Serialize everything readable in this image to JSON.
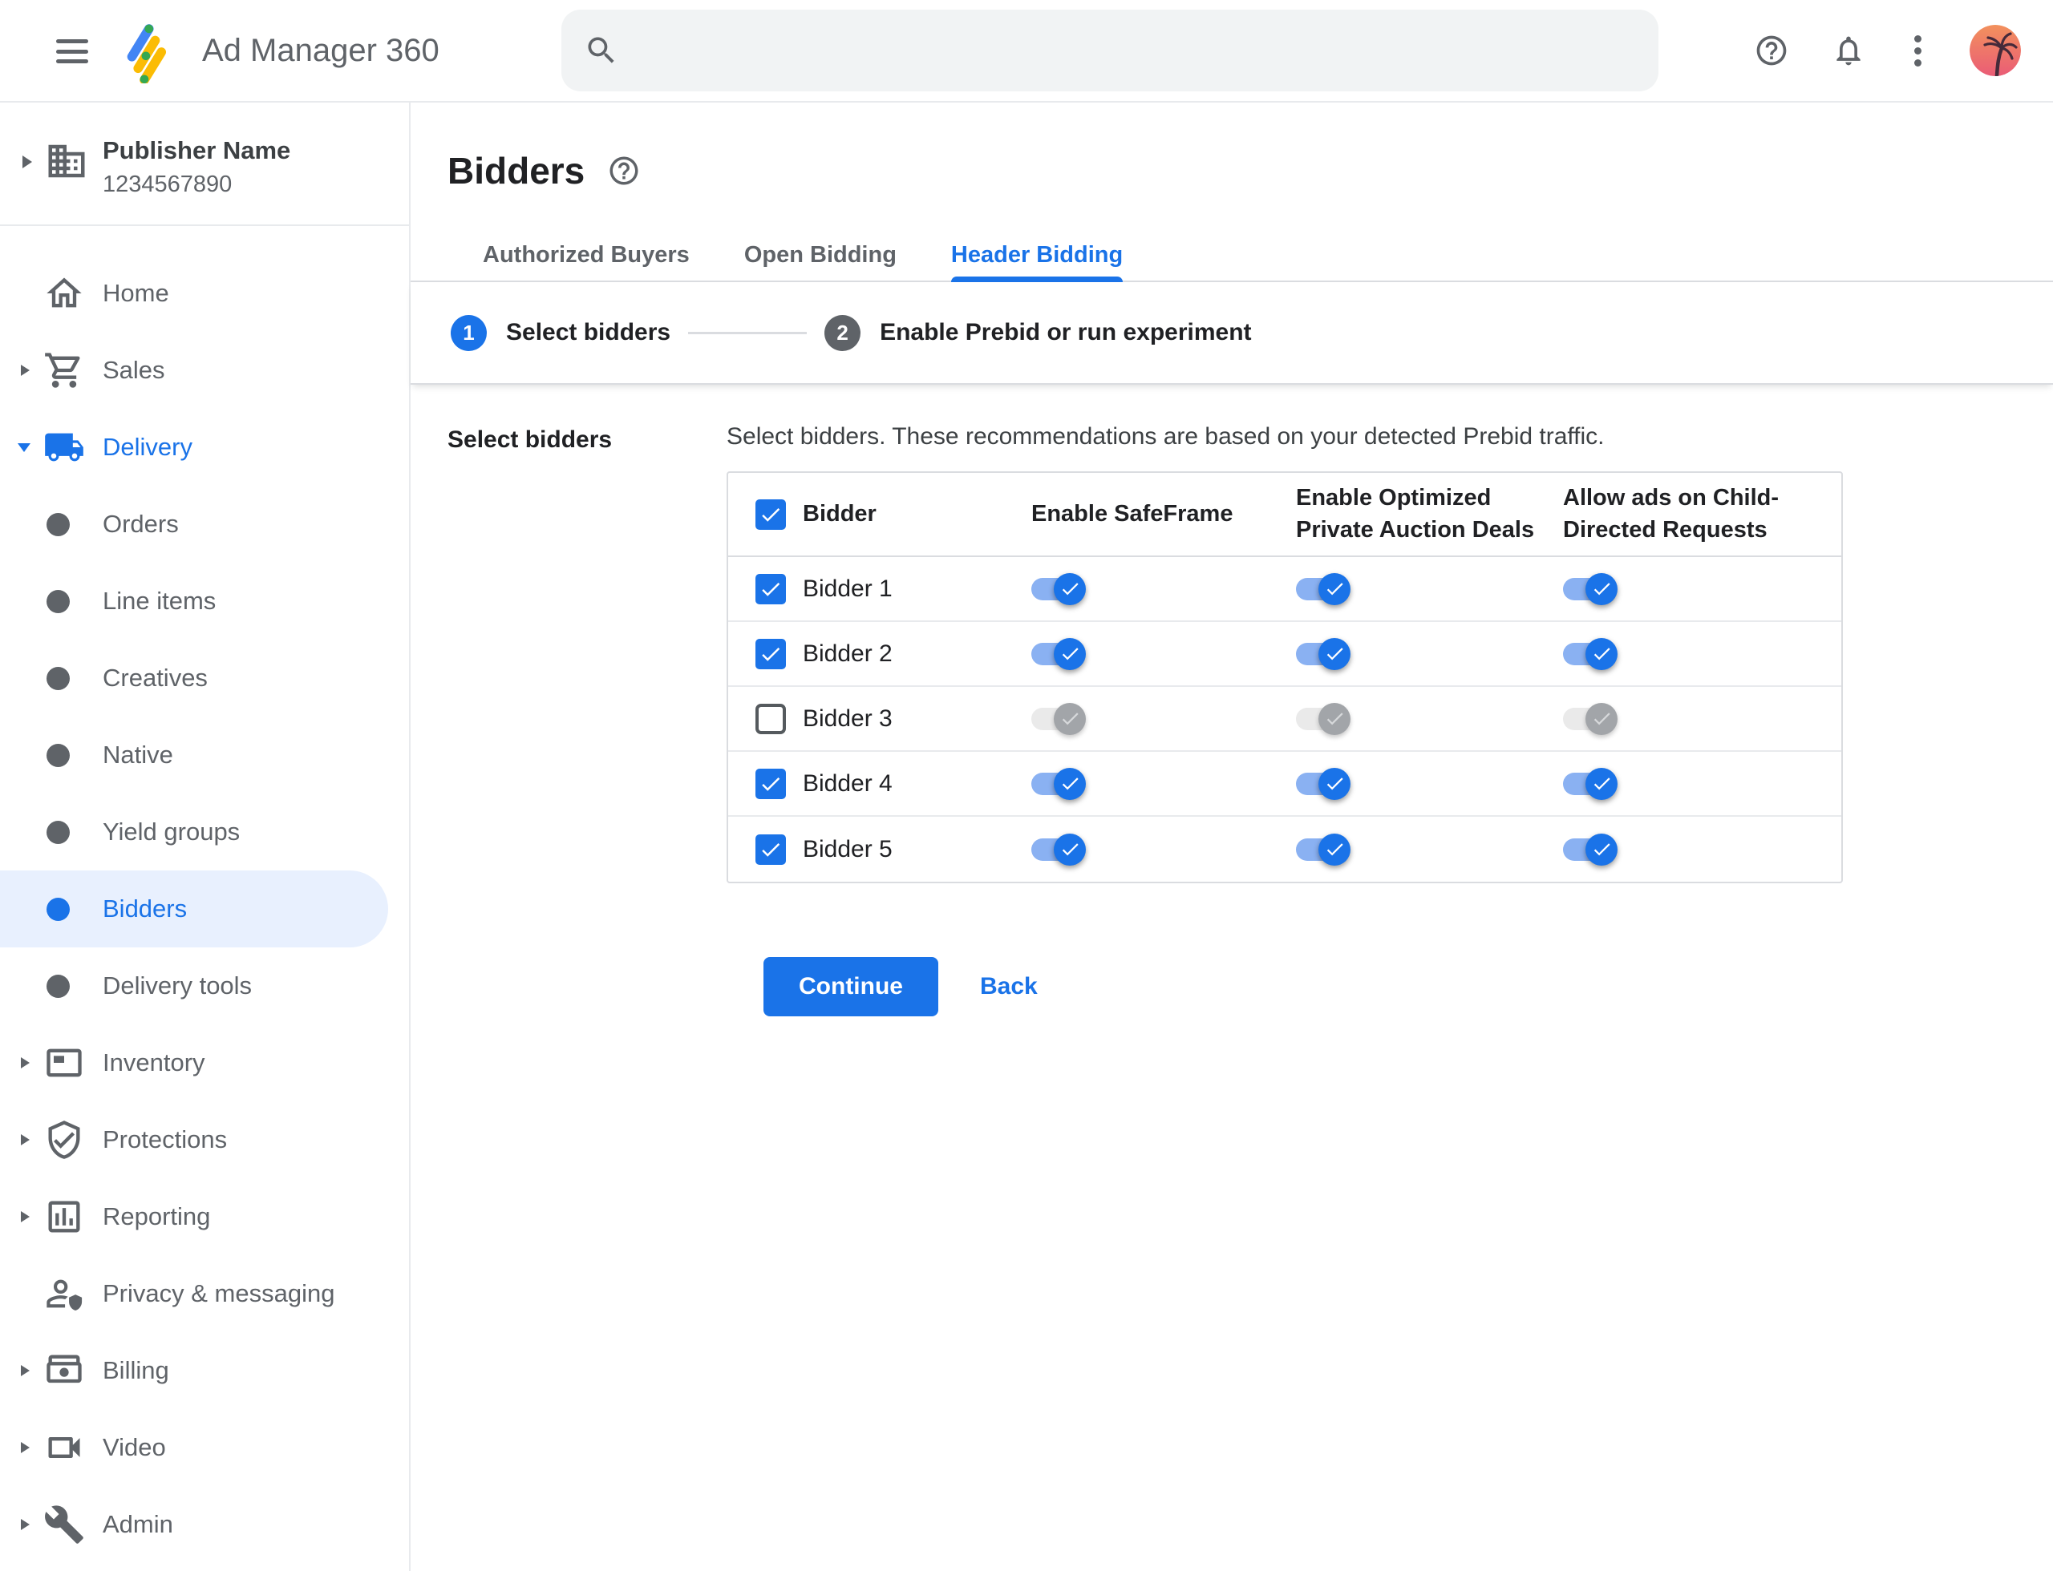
{
  "topbar": {
    "product_name": "Ad Manager 360",
    "search": {
      "placeholder": ""
    }
  },
  "sidebar": {
    "publisher": {
      "name": "Publisher Name",
      "id": "1234567890"
    },
    "items": [
      {
        "label": "Home",
        "icon": "home",
        "arrow": "none",
        "state": "default"
      },
      {
        "label": "Sales",
        "icon": "cart",
        "arrow": "right",
        "state": "default"
      },
      {
        "label": "Delivery",
        "icon": "truck",
        "arrow": "down",
        "state": "blue"
      },
      {
        "label": "Orders",
        "icon": "bullet",
        "arrow": "none",
        "state": "default"
      },
      {
        "label": "Line items",
        "icon": "bullet",
        "arrow": "none",
        "state": "default"
      },
      {
        "label": "Creatives",
        "icon": "bullet",
        "arrow": "none",
        "state": "default"
      },
      {
        "label": "Native",
        "icon": "bullet",
        "arrow": "none",
        "state": "default"
      },
      {
        "label": "Yield groups",
        "icon": "bullet",
        "arrow": "none",
        "state": "default"
      },
      {
        "label": "Bidders",
        "icon": "bullet",
        "arrow": "none",
        "state": "selected"
      },
      {
        "label": "Delivery tools",
        "icon": "bullet",
        "arrow": "none",
        "state": "default"
      },
      {
        "label": "Inventory",
        "icon": "inventory",
        "arrow": "right",
        "state": "default"
      },
      {
        "label": "Protections",
        "icon": "shield",
        "arrow": "right",
        "state": "default"
      },
      {
        "label": "Reporting",
        "icon": "report",
        "arrow": "right",
        "state": "default"
      },
      {
        "label": "Privacy & messaging",
        "icon": "privacy",
        "arrow": "none",
        "state": "default"
      },
      {
        "label": "Billing",
        "icon": "billing",
        "arrow": "right",
        "state": "default"
      },
      {
        "label": "Video",
        "icon": "video",
        "arrow": "right",
        "state": "default"
      },
      {
        "label": "Admin",
        "icon": "admin",
        "arrow": "right",
        "state": "default"
      }
    ]
  },
  "main": {
    "title": "Bidders",
    "tabs": [
      {
        "label": "Authorized Buyers",
        "active": false
      },
      {
        "label": "Open Bidding",
        "active": false
      },
      {
        "label": "Header Bidding",
        "active": true
      }
    ],
    "steps": [
      {
        "number": "1",
        "label": "Select bidders",
        "state": "active"
      },
      {
        "number": "2",
        "label": "Enable Prebid or run experiment",
        "state": "inactive"
      }
    ],
    "form": {
      "section_label": "Select bidders",
      "description": "Select bidders. These recommendations are based on your detected Prebid traffic.",
      "table": {
        "select_all_checked": true,
        "columns": [
          "Bidder",
          "Enable SafeFrame",
          "Enable Optimized Private Auction Deals",
          "Allow ads on Child-Directed Requests"
        ],
        "toggle_keys": [
          "safeframe",
          "optimized-deals",
          "child-directed"
        ],
        "rows": [
          {
            "name": "Bidder 1",
            "selected": true,
            "toggles": [
              true,
              true,
              true
            ]
          },
          {
            "name": "Bidder 2",
            "selected": true,
            "toggles": [
              true,
              true,
              true
            ]
          },
          {
            "name": "Bidder 3",
            "selected": false,
            "toggles": [
              false,
              false,
              false
            ]
          },
          {
            "name": "Bidder 4",
            "selected": true,
            "toggles": [
              true,
              true,
              true
            ]
          },
          {
            "name": "Bidder 5",
            "selected": true,
            "toggles": [
              true,
              true,
              true
            ]
          }
        ]
      },
      "actions": {
        "continue": "Continue",
        "back": "Back"
      }
    }
  },
  "colors": {
    "accent_blue": "#1a73e8",
    "toggle_track_on": "#8ab1f2",
    "toggle_off_thumb": "#a2a5a9",
    "selected_item_bg": "#e8f0fe",
    "text_primary": "#202124",
    "text_secondary": "#5f6368",
    "divider": "#dadce0",
    "search_bg": "#f1f3f4"
  }
}
